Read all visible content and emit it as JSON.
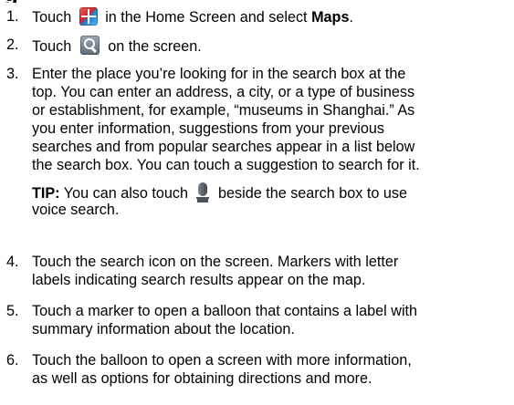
{
  "heading_fragment": "g",
  "steps": [
    {
      "number": "1.",
      "text_before": "Touch",
      "icon": "apps-grid-icon",
      "text_middle": "in the Home Screen and select",
      "bold": "Maps",
      "text_after": "."
    },
    {
      "number": "2.",
      "text_before": "Touch",
      "icon": "search-icon",
      "text_after": "on the screen."
    },
    {
      "number": "3.",
      "lines": [
        "Enter the place you’re looking for in the search box at the",
        "top. You can enter an address, a city, or a type of business",
        "or establishment, for example, “museums in Shanghai.” As",
        "you enter information, suggestions from your previous",
        "searches and from popular searches appear in a list below",
        "the search box. You can touch a suggestion to search for it."
      ],
      "tip": {
        "label": "TIP:",
        "text_before": "You can also touch",
        "icon": "microphone-icon",
        "text_after": "beside the search box to use",
        "line2": "voice search."
      }
    },
    {
      "number": "4.",
      "lines": [
        "Touch the search icon on the screen. Markers with letter",
        "labels indicating search results appear on the map."
      ]
    },
    {
      "number": "5.",
      "lines": [
        "Touch a marker to open a balloon that contains a label with",
        "summary information about the location."
      ]
    },
    {
      "number": "6.",
      "lines": [
        "Touch the balloon to open a screen with more information,",
        "as well as options for obtaining directions and more."
      ]
    }
  ]
}
